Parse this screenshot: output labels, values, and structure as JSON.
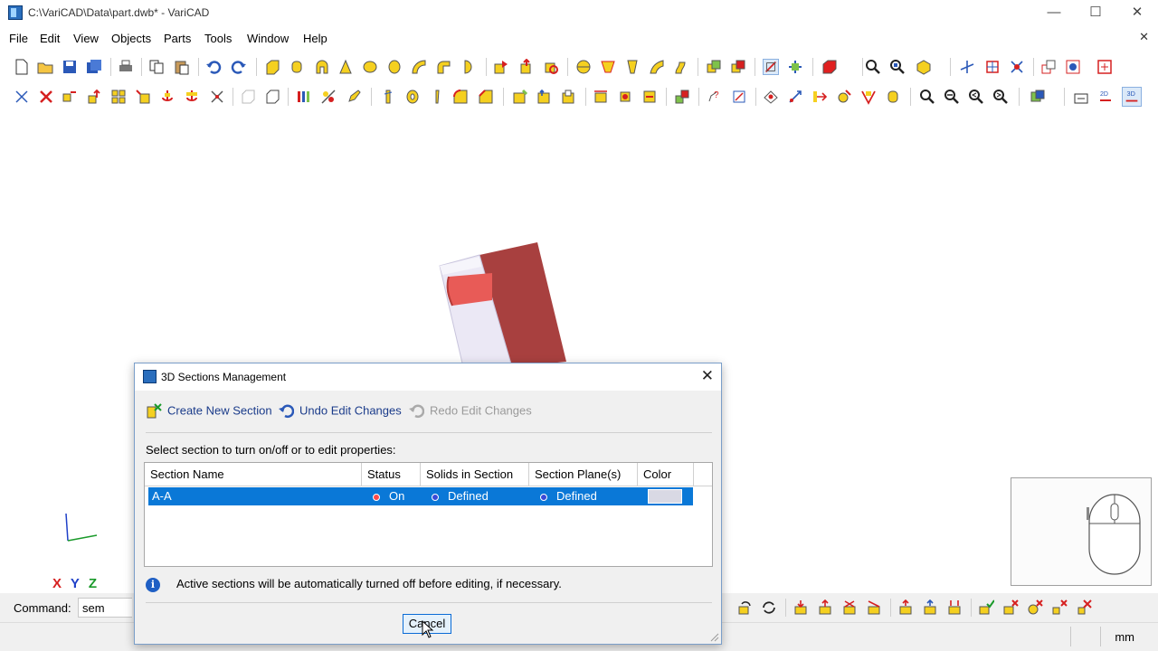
{
  "window": {
    "title": "C:\\VariCAD\\Data\\part.dwb* - VariCAD",
    "controls": {
      "minimize": "—",
      "maximize": "☐",
      "close": "✕"
    }
  },
  "menu": {
    "items": [
      "File",
      "Edit",
      "View",
      "Objects",
      "Parts",
      "Tools",
      "Window",
      "Help"
    ],
    "mdi_close": "✕"
  },
  "colors": {
    "accent_blue": "#0a78d7",
    "part_red_dark": "#a8403f",
    "part_red_light": "#e85b57",
    "part_lilac": "#e9e7f4"
  },
  "command": {
    "label": "Command:",
    "value": "sem"
  },
  "status": {
    "unit": "mm"
  },
  "axes": {
    "labels": [
      "X",
      "Y",
      "Z"
    ]
  },
  "dialog": {
    "title": "3D Sections Management",
    "close": "✕",
    "buttons": {
      "create": "Create New Section",
      "undo": "Undo Edit Changes",
      "redo": "Redo Edit Changes"
    },
    "instruction": "Select section to turn on/off or to edit properties:",
    "columns": [
      "Section Name",
      "Status",
      "Solids in Section",
      "Section Plane(s)",
      "Color"
    ],
    "rows": [
      {
        "name": "A-A",
        "status": "On",
        "solids": "Defined",
        "plane": "Defined",
        "color": "#d9d9e4"
      }
    ],
    "info": "Active sections will be automatically turned off before editing, if necessary.",
    "cancel": "Cancel"
  }
}
